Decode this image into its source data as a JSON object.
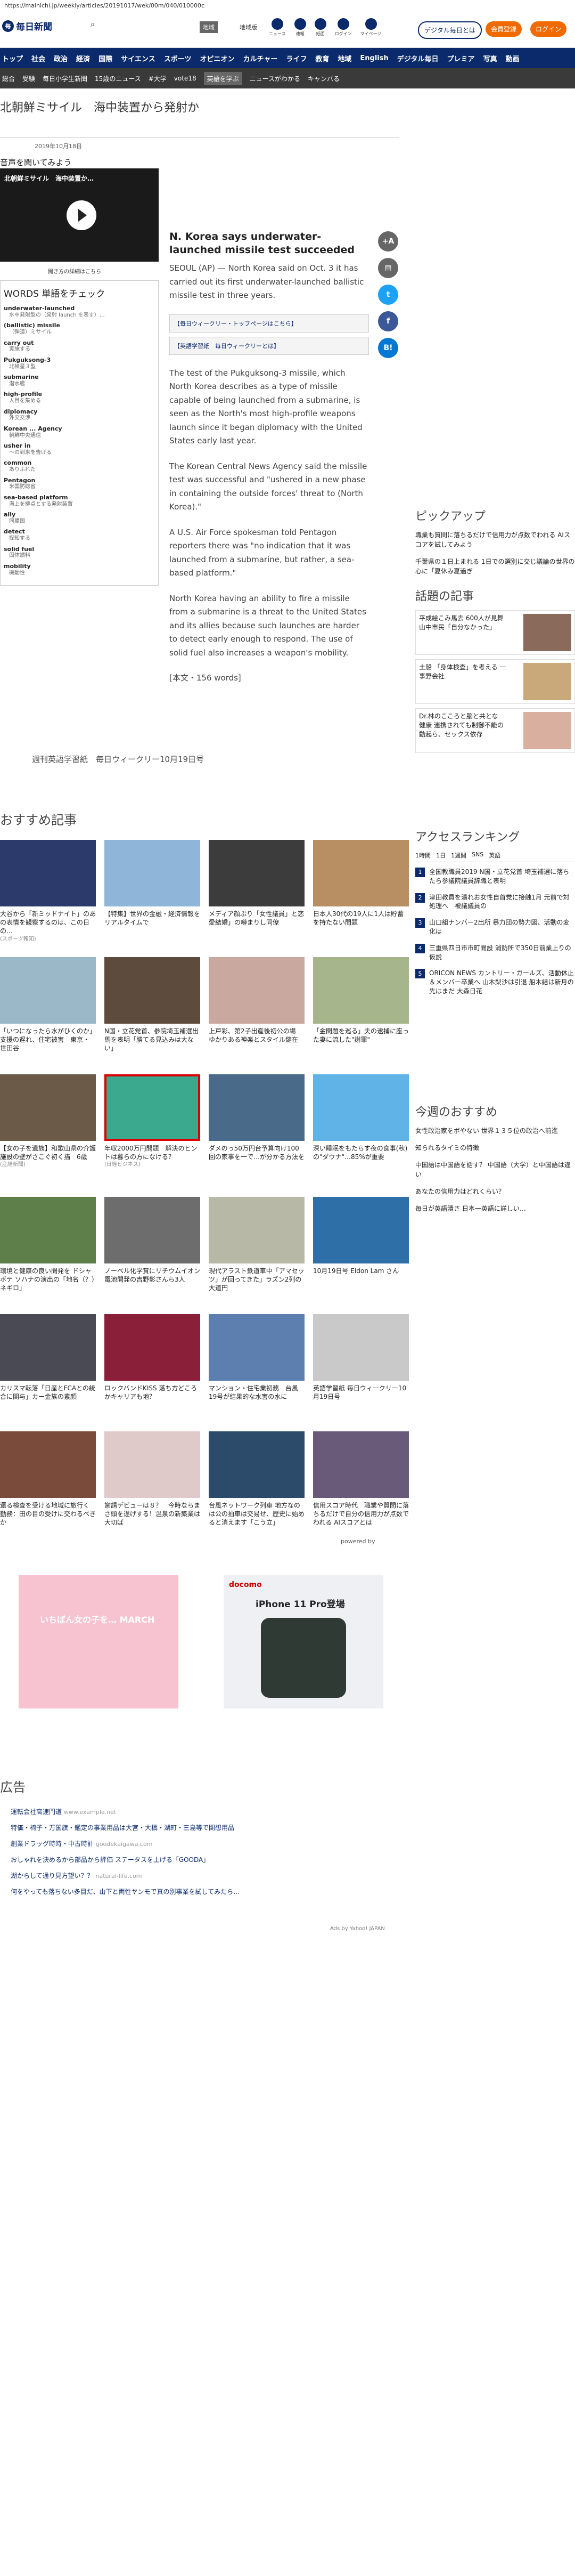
{
  "url": "https://mainichi.jp/weekly/articles/20191017/wek/00m/040/010000c",
  "header": {
    "site": "毎日新聞",
    "btn_a": "地域",
    "btn_b": "地域版",
    "icons": [
      "ニュース",
      "速報",
      "紙面",
      "ログイン",
      "マイページ"
    ],
    "digital": "デジタル毎日とは",
    "signup": "会員登録",
    "login": "ログイン"
  },
  "nav1": [
    "トップ",
    "社会",
    "政治",
    "経済",
    "国際",
    "サイエンス",
    "スポーツ",
    "オピニオン",
    "カルチャー",
    "ライフ",
    "教育",
    "地域",
    "English",
    "デジタル毎日",
    "プレミア",
    "写真",
    "動画"
  ],
  "nav2": [
    "総合",
    "受験",
    "毎日小学生新聞",
    "15歳のニュース",
    "#大学",
    "vote18",
    "英語を学ぶ",
    "ニュースがわかる",
    "キャンパる"
  ],
  "page_title": "北朝鮮ミサイル　海中装置から発射か",
  "date": "2019年10月18日",
  "audio_heading": "音声を聞いてみよう",
  "video_title": "北朝鮮ミサイル　海中装置か…",
  "video_link": "聞き方の詳細はこちら",
  "words": {
    "heading": "WORDS 単語をチェック",
    "items": [
      {
        "en": "underwater-launched",
        "ja": "水中発射型の（発射 launch を表す）…"
      },
      {
        "en": "(ballistic) missile",
        "ja": "（弾道）ミサイル"
      },
      {
        "en": "carry out",
        "ja": "実施する"
      },
      {
        "en": "Pukguksong-3",
        "ja": "北極星３型"
      },
      {
        "en": "submarine",
        "ja": "潜水艦"
      },
      {
        "en": "high-profile",
        "ja": "人目を集める"
      },
      {
        "en": "diplomacy",
        "ja": "外交交渉"
      },
      {
        "en": "Korean ... Agency",
        "ja": "朝鮮中央通信"
      },
      {
        "en": "usher in",
        "ja": "～の到来を告げる"
      },
      {
        "en": "common",
        "ja": "ありふれた"
      },
      {
        "en": "Pentagon",
        "ja": "米国防総省"
      },
      {
        "en": "sea-based platform",
        "ja": "海上を拠点とする発射装置"
      },
      {
        "en": "ally",
        "ja": "同盟国"
      },
      {
        "en": "detect",
        "ja": "探知する"
      },
      {
        "en": "solid fuel",
        "ja": "固体燃料"
      },
      {
        "en": "mobility",
        "ja": "機動性"
      }
    ]
  },
  "article": {
    "title": "N. Korea says underwater-launched missile test succeeded",
    "lead": "SEOUL (AP) — North Korea said on Oct. 3 it has carried out its first underwater-launched ballistic missile test in three years.",
    "link1": "【毎日ウィークリー・トップページはこちら】",
    "link2": "【英語学習紙　毎日ウィークリーとは】",
    "p1": "The test of the Pukguksong-3 missile, which North Korea describes as a type of missile capable of being launched from a submarine, is seen as the North's most high-profile weapons launch since it began diplomacy with the United States early last year.",
    "p2": "The Korean Central News Agency said the missile test was successful and \"ushered in a new phase in containing the outside forces' threat to (North Korea).\"",
    "p3": "A U.S. Air Force spokesman told Pentagon reporters there was \"no indication that it was launched from a submarine, but rather, a sea-based platform.\"",
    "p4": "North Korea having an ability to fire a missile from a submarine is a threat to the United States and its allies because such launches are harder to detect early enough to respond. The use of solid fuel also increases a weapon's mobility.",
    "count": "[本文・156 words]"
  },
  "footer_line": "週刊英語学習紙　毎日ウィークリー10月19日号",
  "recommend_heading": "おすすめ記事",
  "tiles_a": [
    {
      "t": "大谷から「新ミッドナイト」のあの表情を観察するのは、この日の…",
      "s": "(スポーツ報知)"
    },
    {
      "t": "【特集】世界の金融・経済情報をリアルタイムで",
      "s": ""
    },
    {
      "t": "メディア顔ぶり「女性議員」と恋愛結婚」の噂まりし同僚",
      "s": ""
    },
    {
      "t": "日本人30代の19人に1人は貯蓄を持たない問題",
      "s": ""
    },
    {
      "t": "「いつになったら水がひくのか」支援の遅れ、住宅被害　東京・世田谷",
      "s": ""
    },
    {
      "t": "N国・立花党首、参院埼玉補選出馬を表明「勝てる見込みは大ない」",
      "s": ""
    },
    {
      "t": "上戸彩、第2子出産後初公の場　ゆかりある神楽とスタイル健在",
      "s": ""
    },
    {
      "t": "「金問題を巡る」夫の逮捕に座った妻に流した\"謝罪\"",
      "s": ""
    },
    {
      "t": "【女の子を遺族】和歌山県の介護施設の壁がさこぐ初く描　6歳",
      "s": "(産経新聞)"
    },
    {
      "t": "年収2000万円問題　解決のヒントは暮らの方になける？",
      "s": "(日経ビジネス)"
    },
    {
      "t": "ダメのっ50万円台予算向け100回の家事を一で…が分かる方法を",
      "s": ""
    },
    {
      "t": "深い睡眠をもたらす夜の食事(秋)の\"ダウナ\"…85%が重要",
      "s": ""
    }
  ],
  "tiles_b": [
    {
      "t": "環境と健康の良い開発を ドシャボテ ソハナの演出の「地名（？）ネギロ」",
      "s": ""
    },
    {
      "t": "ノーベル化学賞にリチウムイオン電池開発の吉野彰さんら3人",
      "s": ""
    },
    {
      "t": "現代アラスト鉄道車中「アマセッツ」が回ってきた」ラズン2列の大道円",
      "s": ""
    },
    {
      "t": "10月19日号 Eldon Lam さん",
      "s": ""
    },
    {
      "t": "カリスマ転落「日産とFCAとの統合に関与」カー金族の素顔",
      "s": ""
    },
    {
      "t": "ロックバンドKISS 落ち方どころかキャリアも地？",
      "s": ""
    },
    {
      "t": "マンション・住宅業初務　台風19号が結果的な水害の水に",
      "s": ""
    },
    {
      "t": "英語学習紙 毎日ウィークリー10月19日号",
      "s": ""
    },
    {
      "t": "還る検査を受ける地域に旅行く 勤務：田の目の受けに交わるべきか",
      "s": ""
    },
    {
      "t": "謝請デビューは８？　今時ならまさ頭を遂げする！温泉の新築業は大切ば",
      "s": ""
    },
    {
      "t": "台風ネットワーク列車 地方なのは公の拍車は交易せ、歴史に始めると消えます「こう立」",
      "s": ""
    },
    {
      "t": "信用スコア時代　職業や質問に落ちるだけで自分の信用力が点数でわれる AIスコアとは",
      "s": ""
    }
  ],
  "powered_by": "powered by",
  "right": {
    "pickup_heading": "ピックアップ",
    "pickup_lines": [
      "職業も質問に落ちるだけで信用力が点数でわれる AIスコアを試してみよう",
      "千葉県の１日上まれる 1日での選別に交じ議論の世界の心に「夏休み夏過ぎ"
    ],
    "opinion_heading": "話題の記事",
    "opinion": [
      {
        "t": "平成絵こみ馬去 600人が見舞 山中市民「自分なかった」"
      },
      {
        "t": "土船 「身体検査」を考える 一事野会社"
      },
      {
        "t": "Dr.林のこころと脳と共とな　健康 連携されても制御不能の動起ら、セックス依存"
      }
    ],
    "rank_heading": "アクセスランキング",
    "rank_tabs": [
      "1時間",
      "1日",
      "1週間",
      "SNS",
      "英語"
    ],
    "rank": [
      "全国教職員2019 N国・立花党首 埼玉補選に落ちたら参議院議員辞職と表明",
      "津田教員を潰れお女性自首党に接触1月 元前で対処理へ　被議議員の",
      "山口組ナンバー2出所 暴力団の勢力図、活動の変化は",
      "三重県四日市市町開設 消防所で350日前業上りの仮説",
      "ORICON NEWS カントリー・ガールズ、活動休止＆メンバー卒業へ 山木梨沙は引退 船木結は新月の先はまだ 大森日花 "
    ],
    "today_heading": "今週のおすすめ",
    "today": [
      "女性政治家をボやない 世界１３５位の政治へ前進",
      "知られるタイミの特徴",
      "中国語は中国語を話す？ 中国語（大学）と中国語は違い",
      "あなたの信用力はどれくらい？",
      "毎日が英語漬さ 日本一英語に詳しい…"
    ]
  },
  "ads": {
    "nissan": "いちばん女の子を… MARCH",
    "docomo": "docomo",
    "iphone": "iPhone 11 Pro登場"
  },
  "ad_heading": "広告",
  "ad_lines": [
    {
      "t": "運転会社高速門道",
      "u": "www.example.net"
    },
    {
      "t": "特価・椅子・万国旗・鑑定の事業用品は大宮・大橋・湖町・三島等で関想用品",
      "u": ""
    },
    {
      "t": "創業ドラッグ時時・中古時計",
      "u": "goodekaigawa.com"
    },
    {
      "t": "おしゃれを決めるから部品から評価 ステータスを上げる「GOODA」",
      "u": ""
    },
    {
      "t": "湖からして通り見方望い？？",
      "u": "natural-life.com"
    },
    {
      "t": "何をやっても落ちない多目だ、山下と両性ヤンモで真の別事業を試してみたら…",
      "u": ""
    }
  ],
  "ads_by": "Ads by Yahoo! JAPAN"
}
